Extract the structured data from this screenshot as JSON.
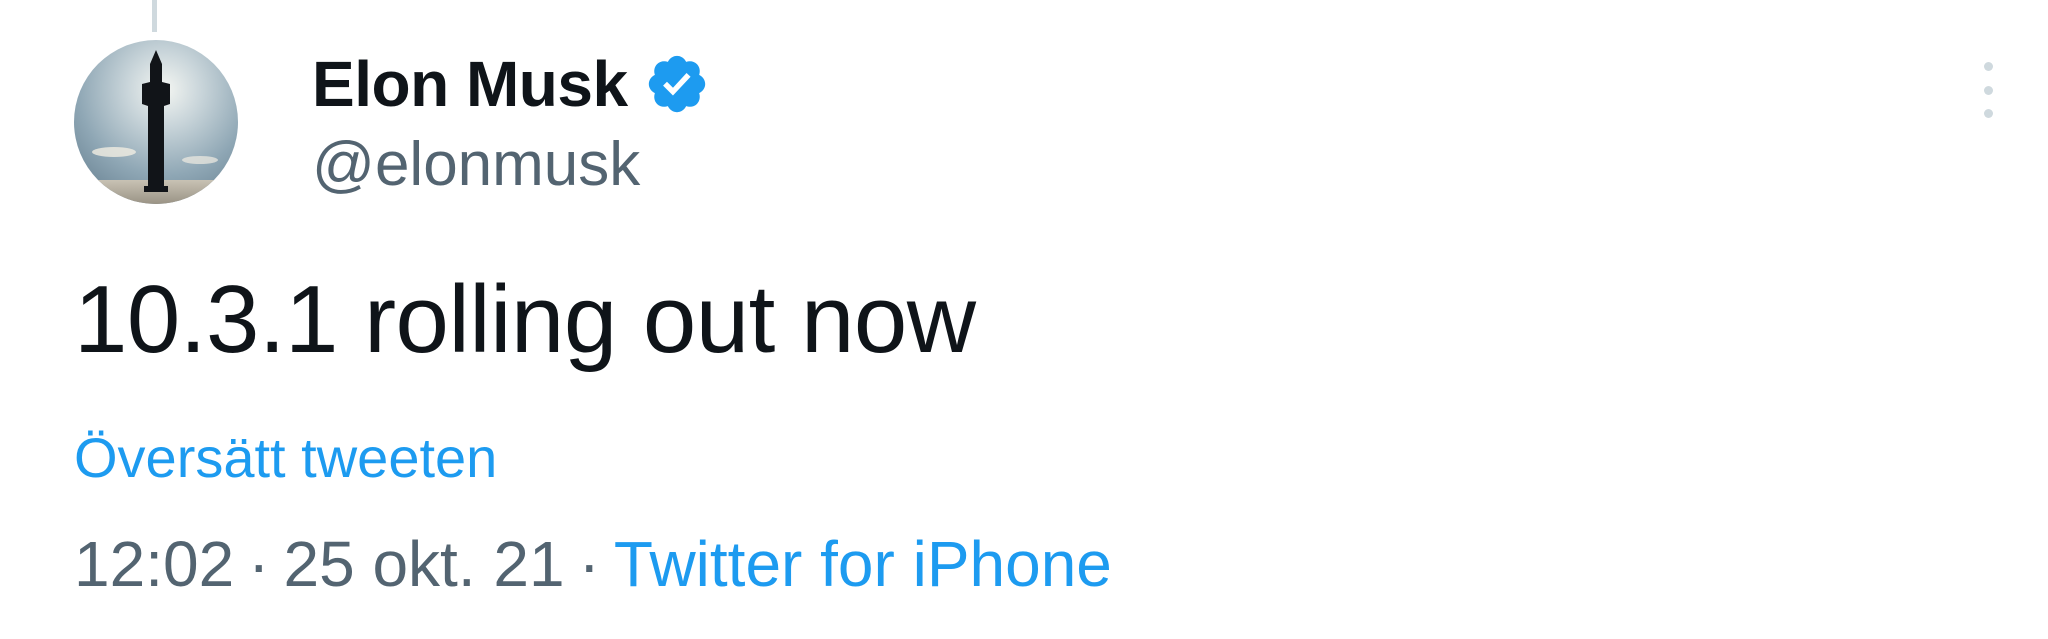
{
  "tweet": {
    "author": {
      "display_name": "Elon Musk",
      "handle": "@elonmusk",
      "verified": true,
      "verified_icon": "verified-badge-icon",
      "avatar_icon": "rocket-silhouette-avatar"
    },
    "text": "10.3.1 rolling out now",
    "translate_label": "Översätt tweeten",
    "time": "12:02",
    "date": "25 okt. 21",
    "separator": "·",
    "source": "Twitter for iPhone",
    "more_icon": "more-options-icon"
  },
  "colors": {
    "text_primary": "#0f1419",
    "text_secondary": "#536471",
    "accent": "#1d9bf0",
    "thread_line": "#cfd9de"
  }
}
